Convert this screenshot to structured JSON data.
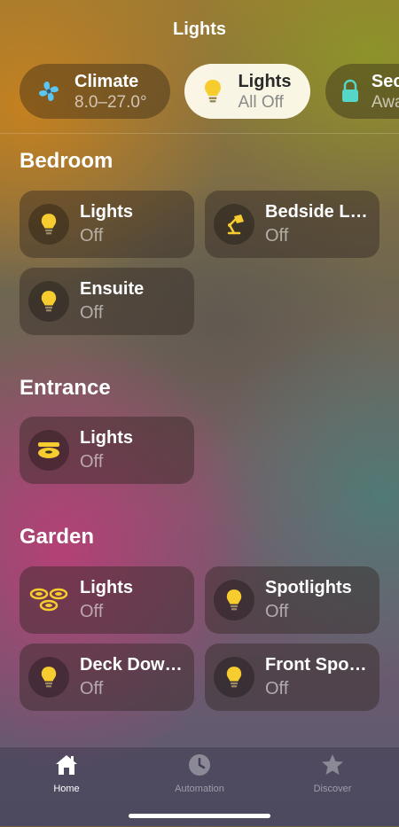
{
  "header": {
    "title": "Lights"
  },
  "categories": [
    {
      "name": "Climate",
      "status": "8.0–27.0°",
      "icon": "fan-icon"
    },
    {
      "name": "Lights",
      "status": "All Off",
      "icon": "bulb-icon",
      "active": true
    },
    {
      "name": "Security",
      "status": "Away",
      "icon": "lock-icon"
    }
  ],
  "rooms": {
    "bedroom": {
      "title": "Bedroom",
      "tiles": [
        {
          "name": "Lights",
          "state": "Off",
          "icon": "bulb-icon"
        },
        {
          "name": "Bedside Lamp",
          "state": "Off",
          "icon": "desk-lamp-icon"
        },
        {
          "name": "Ensuite",
          "state": "Off",
          "icon": "bulb-icon"
        }
      ]
    },
    "entrance": {
      "title": "Entrance",
      "tiles": [
        {
          "name": "Lights",
          "state": "Off",
          "icon": "ceiling-light-icon"
        }
      ]
    },
    "garden": {
      "title": "Garden",
      "tiles": [
        {
          "name": "Lights",
          "state": "Off",
          "icon": "downlights-icon"
        },
        {
          "name": "Spotlights",
          "state": "Off",
          "icon": "bulb-icon"
        },
        {
          "name": "Deck Downlights",
          "state": "Off",
          "icon": "bulb-icon"
        },
        {
          "name": "Front Spotlights",
          "state": "Off",
          "icon": "bulb-icon"
        }
      ]
    }
  },
  "tabbar": {
    "home": "Home",
    "automation": "Automation",
    "discover": "Discover"
  },
  "colors": {
    "accent_bulb": "#f7cc2e",
    "climate_icon": "#5cc6f2",
    "security_icon": "#55d6c6"
  }
}
